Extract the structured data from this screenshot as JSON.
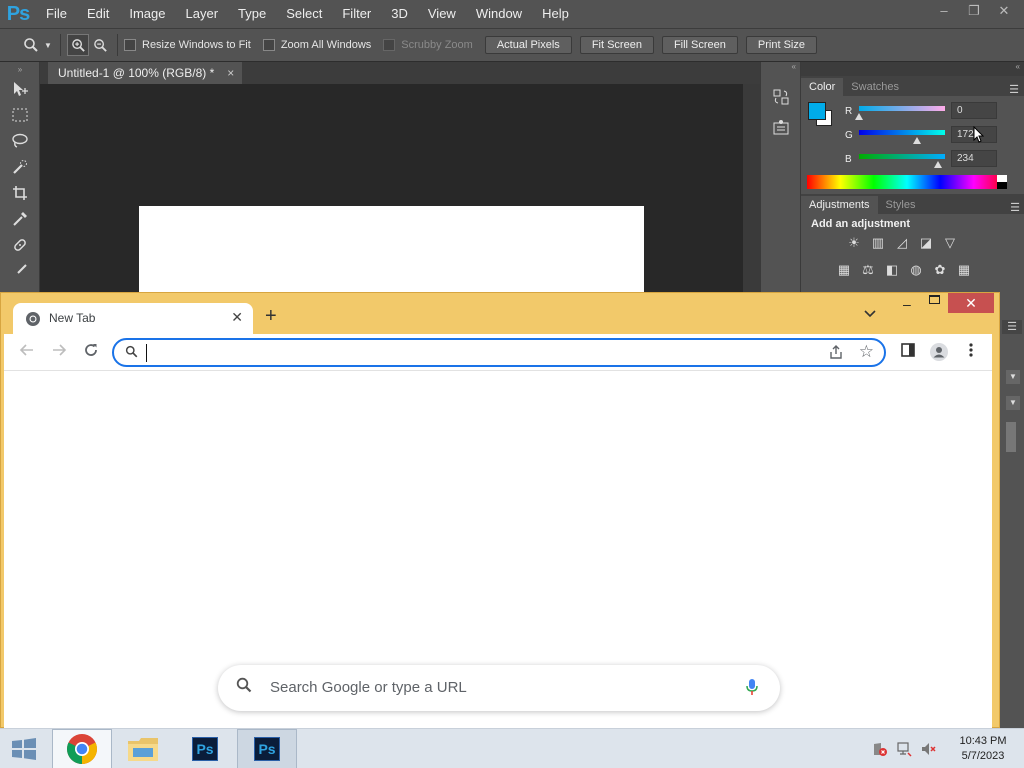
{
  "photoshop": {
    "logo": "Ps",
    "menu": [
      "File",
      "Edit",
      "Image",
      "Layer",
      "Type",
      "Select",
      "Filter",
      "3D",
      "View",
      "Window",
      "Help"
    ],
    "window_controls": [
      "–",
      "❐",
      "✕"
    ],
    "options": {
      "resize_windows": "Resize Windows to Fit",
      "zoom_all": "Zoom All Windows",
      "scrubby_zoom": "Scrubby Zoom",
      "buttons": [
        "Actual Pixels",
        "Fit Screen",
        "Fill Screen",
        "Print Size"
      ]
    },
    "document_tab": "Untitled-1 @ 100% (RGB/8) *",
    "panels": {
      "color_tabs": [
        "Color",
        "Swatches"
      ],
      "r_label": "R",
      "g_label": "G",
      "b_label": "B",
      "r_value": "0",
      "g_value": "172",
      "b_value": "234",
      "r_level": 0,
      "g_level": 172,
      "b_level": 234,
      "foreground_color": "#00acea",
      "adjustment_tabs": [
        "Adjustments",
        "Styles"
      ],
      "adjustment_title": "Add an adjustment"
    }
  },
  "chrome": {
    "tab_title": "New Tab",
    "new_tab": "+",
    "search_placeholder": "Search Google or type a URL",
    "omnibox_value": ""
  },
  "taskbar": {
    "ps_label": "Ps",
    "time": "10:43 PM",
    "date": "5/7/2023"
  }
}
